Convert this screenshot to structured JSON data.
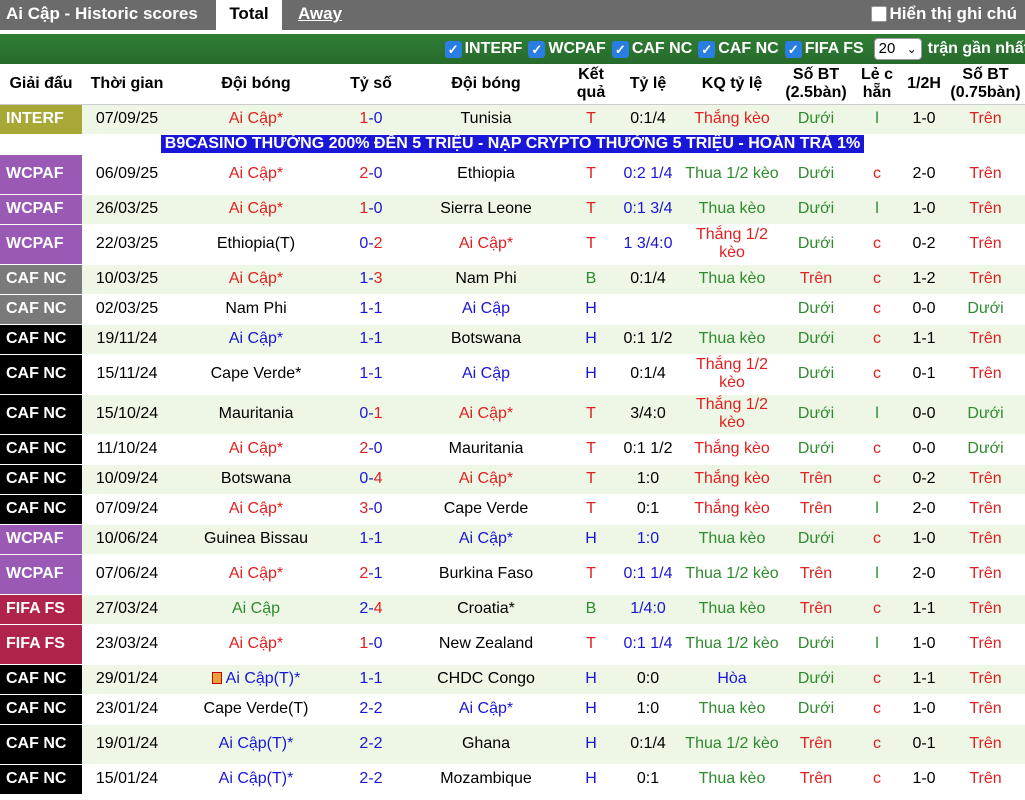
{
  "topbar": {
    "title": "Ai Cập - Historic scores",
    "tab_total": "Total",
    "tab_away": "Away",
    "show_note_label": "Hiển thị ghi chú"
  },
  "filters": {
    "items": [
      "INTERF",
      "WCPAF",
      "CAF NC",
      "CAF NC",
      "FIFA FS"
    ],
    "select_value": "20",
    "select_suffix": "trận gần nhất"
  },
  "headers": [
    "Giải đấu",
    "Thời gian",
    "Đội bóng",
    "Tỷ số",
    "Đội bóng",
    "Kết quả",
    "Tỷ lệ",
    "KQ tỷ lệ",
    "Số BT (2.5bàn)",
    "Lẻ c hẵn",
    "1/2H",
    "Số BT (0.75bàn)"
  ],
  "banner": "B9CASINO THƯỞNG 200% ĐẾN 5 TRIỆU - NẠP CRYPTO THƯỞNG 5 TRIỆU - HOÀN TRẢ 1%",
  "league_colors": {
    "INTERF": "#a8a838",
    "WCPAF": "#9b59b6",
    "CAF NC": "#000000",
    "CAF NC gray": "#7a7a7a",
    "FIFA FS": "#b0234a"
  },
  "rows": [
    {
      "league": "INTERF",
      "color": "#a8a838",
      "date": "07/09/25",
      "home": "Ai Cập*",
      "hc": "red",
      "s1": "1",
      "s2": "0",
      "away": "Tunisia",
      "ac": "dk",
      "res": "T",
      "rc": "red",
      "odds": "0:1/4",
      "oc": "dk",
      "kq": "Thắng kèo",
      "kc": "red",
      "bt": "Dưới",
      "bc": "green",
      "lc": "l",
      "lcc": "green",
      "h": "1-0",
      "bt2": "Trên",
      "b2c": "red",
      "tall": false
    },
    {
      "league": "WCPAF",
      "color": "#9b59b6",
      "date": "06/09/25",
      "home": "Ai Cập*",
      "hc": "red",
      "s1": "2",
      "s2": "0",
      "away": "Ethiopia",
      "ac": "dk",
      "res": "T",
      "rc": "red",
      "odds": "0:2 1/4",
      "oc": "blue",
      "kq": "Thua 1/2 kèo",
      "kc": "green",
      "bt": "Dưới",
      "bc": "green",
      "lc": "c",
      "lcc": "red",
      "h": "2-0",
      "bt2": "Trên",
      "b2c": "red",
      "tall": true
    },
    {
      "league": "WCPAF",
      "color": "#9b59b6",
      "date": "26/03/25",
      "home": "Ai Cập*",
      "hc": "red",
      "s1": "1",
      "s2": "0",
      "away": "Sierra Leone",
      "ac": "dk",
      "res": "T",
      "rc": "red",
      "odds": "0:1 3/4",
      "oc": "blue",
      "kq": "Thua kèo",
      "kc": "green",
      "bt": "Dưới",
      "bc": "green",
      "lc": "l",
      "lcc": "green",
      "h": "1-0",
      "bt2": "Trên",
      "b2c": "red",
      "tall": false
    },
    {
      "league": "WCPAF",
      "color": "#9b59b6",
      "date": "22/03/25",
      "home": "Ethiopia(T)",
      "hc": "dk",
      "s1": "0",
      "s2": "2",
      "away": "Ai Cập*",
      "ac": "red",
      "res": "T",
      "rc": "red",
      "odds": "1 3/4:0",
      "oc": "blue",
      "kq": "Thắng 1/2 kèo",
      "kc": "red",
      "bt": "Dưới",
      "bc": "green",
      "lc": "c",
      "lcc": "red",
      "h": "0-2",
      "bt2": "Trên",
      "b2c": "red",
      "tall": true
    },
    {
      "league": "CAF NC",
      "color": "#7a7a7a",
      "date": "10/03/25",
      "home": "Ai Cập*",
      "hc": "red",
      "s1": "1",
      "s2": "3",
      "away": "Nam Phi",
      "ac": "dk",
      "res": "B",
      "rc": "green",
      "odds": "0:1/4",
      "oc": "dk",
      "kq": "Thua kèo",
      "kc": "green",
      "bt": "Trên",
      "bc": "red",
      "lc": "c",
      "lcc": "red",
      "h": "1-2",
      "bt2": "Trên",
      "b2c": "red",
      "tall": false
    },
    {
      "league": "CAF NC",
      "color": "#7a7a7a",
      "date": "02/03/25",
      "home": "Nam Phi",
      "hc": "dk",
      "s1": "1",
      "s2": "1",
      "away": "Ai Cập",
      "ac": "blue",
      "res": "H",
      "rc": "blue",
      "odds": "",
      "oc": "dk",
      "kq": "",
      "kc": "dk",
      "bt": "Dưới",
      "bc": "green",
      "lc": "c",
      "lcc": "red",
      "h": "0-0",
      "bt2": "Dưới",
      "b2c": "green",
      "tall": false
    },
    {
      "league": "CAF NC",
      "color": "#000000",
      "date": "19/11/24",
      "home": "Ai Cập*",
      "hc": "blue",
      "s1": "1",
      "s2": "1",
      "away": "Botswana",
      "ac": "dk",
      "res": "H",
      "rc": "blue",
      "odds": "0:1 1/2",
      "oc": "dk",
      "kq": "Thua kèo",
      "kc": "green",
      "bt": "Dưới",
      "bc": "green",
      "lc": "c",
      "lcc": "red",
      "h": "1-1",
      "bt2": "Trên",
      "b2c": "red",
      "tall": false
    },
    {
      "league": "CAF NC",
      "color": "#000000",
      "date": "15/11/24",
      "home": "Cape Verde*",
      "hc": "dk",
      "s1": "1",
      "s2": "1",
      "away": "Ai Cập",
      "ac": "blue",
      "res": "H",
      "rc": "blue",
      "odds": "0:1/4",
      "oc": "dk",
      "kq": "Thắng 1/2 kèo",
      "kc": "red",
      "bt": "Dưới",
      "bc": "green",
      "lc": "c",
      "lcc": "red",
      "h": "0-1",
      "bt2": "Trên",
      "b2c": "red",
      "tall": true
    },
    {
      "league": "CAF NC",
      "color": "#000000",
      "date": "15/10/24",
      "home": "Mauritania",
      "hc": "dk",
      "s1": "0",
      "s2": "1",
      "away": "Ai Cập*",
      "ac": "red",
      "res": "T",
      "rc": "red",
      "odds": "3/4:0",
      "oc": "dk",
      "kq": "Thắng 1/2 kèo",
      "kc": "red",
      "bt": "Dưới",
      "bc": "green",
      "lc": "l",
      "lcc": "green",
      "h": "0-0",
      "bt2": "Dưới",
      "b2c": "green",
      "tall": true
    },
    {
      "league": "CAF NC",
      "color": "#000000",
      "date": "11/10/24",
      "home": "Ai Cập*",
      "hc": "red",
      "s1": "2",
      "s2": "0",
      "away": "Mauritania",
      "ac": "dk",
      "res": "T",
      "rc": "red",
      "odds": "0:1 1/2",
      "oc": "dk",
      "kq": "Thắng kèo",
      "kc": "red",
      "bt": "Dưới",
      "bc": "green",
      "lc": "c",
      "lcc": "red",
      "h": "0-0",
      "bt2": "Dưới",
      "b2c": "green",
      "tall": false
    },
    {
      "league": "CAF NC",
      "color": "#000000",
      "date": "10/09/24",
      "home": "Botswana",
      "hc": "dk",
      "s1": "0",
      "s2": "4",
      "away": "Ai Cập*",
      "ac": "red",
      "res": "T",
      "rc": "red",
      "odds": "1:0",
      "oc": "dk",
      "kq": "Thắng kèo",
      "kc": "red",
      "bt": "Trên",
      "bc": "red",
      "lc": "c",
      "lcc": "red",
      "h": "0-2",
      "bt2": "Trên",
      "b2c": "red",
      "tall": false
    },
    {
      "league": "CAF NC",
      "color": "#000000",
      "date": "07/09/24",
      "home": "Ai Cập*",
      "hc": "red",
      "s1": "3",
      "s2": "0",
      "away": "Cape Verde",
      "ac": "dk",
      "res": "T",
      "rc": "red",
      "odds": "0:1",
      "oc": "dk",
      "kq": "Thắng kèo",
      "kc": "red",
      "bt": "Trên",
      "bc": "red",
      "lc": "l",
      "lcc": "green",
      "h": "2-0",
      "bt2": "Trên",
      "b2c": "red",
      "tall": false
    },
    {
      "league": "WCPAF",
      "color": "#9b59b6",
      "date": "10/06/24",
      "home": "Guinea Bissau",
      "hc": "dk",
      "s1": "1",
      "s2": "1",
      "away": "Ai Cập*",
      "ac": "blue",
      "res": "H",
      "rc": "blue",
      "odds": "1:0",
      "oc": "blue",
      "kq": "Thua kèo",
      "kc": "green",
      "bt": "Dưới",
      "bc": "green",
      "lc": "c",
      "lcc": "red",
      "h": "1-0",
      "bt2": "Trên",
      "b2c": "red",
      "tall": false
    },
    {
      "league": "WCPAF",
      "color": "#9b59b6",
      "date": "07/06/24",
      "home": "Ai Cập*",
      "hc": "red",
      "s1": "2",
      "s2": "1",
      "away": "Burkina Faso",
      "ac": "dk",
      "res": "T",
      "rc": "red",
      "odds": "0:1 1/4",
      "oc": "blue",
      "kq": "Thua 1/2 kèo",
      "kc": "green",
      "bt": "Trên",
      "bc": "red",
      "lc": "l",
      "lcc": "green",
      "h": "2-0",
      "bt2": "Trên",
      "b2c": "red",
      "tall": true
    },
    {
      "league": "FIFA FS",
      "color": "#b0234a",
      "date": "27/03/24",
      "home": "Ai Cập",
      "hc": "green",
      "s1": "2",
      "s2": "4",
      "away": "Croatia*",
      "ac": "dk",
      "res": "B",
      "rc": "green",
      "odds": "1/4:0",
      "oc": "blue",
      "kq": "Thua kèo",
      "kc": "green",
      "bt": "Trên",
      "bc": "red",
      "lc": "c",
      "lcc": "red",
      "h": "1-1",
      "bt2": "Trên",
      "b2c": "red",
      "tall": false
    },
    {
      "league": "FIFA FS",
      "color": "#b0234a",
      "date": "23/03/24",
      "home": "Ai Cập*",
      "hc": "red",
      "s1": "1",
      "s2": "0",
      "away": "New Zealand",
      "ac": "dk",
      "res": "T",
      "rc": "red",
      "odds": "0:1 1/4",
      "oc": "blue",
      "kq": "Thua 1/2 kèo",
      "kc": "green",
      "bt": "Dưới",
      "bc": "green",
      "lc": "l",
      "lcc": "green",
      "h": "1-0",
      "bt2": "Trên",
      "b2c": "red",
      "tall": true
    },
    {
      "league": "CAF NC",
      "color": "#000000",
      "date": "29/01/24",
      "home": "Ai Cập(T)*",
      "hc": "blue",
      "flag": true,
      "s1": "1",
      "s2": "1",
      "away": "CHDC Congo",
      "ac": "dk",
      "res": "H",
      "rc": "blue",
      "odds": "0:0",
      "oc": "dk",
      "kq": "Hòa",
      "kc": "blue",
      "bt": "Dưới",
      "bc": "green",
      "lc": "c",
      "lcc": "red",
      "h": "1-1",
      "bt2": "Trên",
      "b2c": "red",
      "tall": false
    },
    {
      "league": "CAF NC",
      "color": "#000000",
      "date": "23/01/24",
      "home": "Cape Verde(T)",
      "hc": "dk",
      "s1": "2",
      "s2": "2",
      "away": "Ai Cập*",
      "ac": "blue",
      "res": "H",
      "rc": "blue",
      "odds": "1:0",
      "oc": "dk",
      "kq": "Thua kèo",
      "kc": "green",
      "bt": "Dưới",
      "bc": "green",
      "lc": "c",
      "lcc": "red",
      "h": "1-0",
      "bt2": "Trên",
      "b2c": "red",
      "tall": false
    },
    {
      "league": "CAF NC",
      "color": "#000000",
      "date": "19/01/24",
      "home": "Ai Cập(T)*",
      "hc": "blue",
      "s1": "2",
      "s2": "2",
      "away": "Ghana",
      "ac": "dk",
      "res": "H",
      "rc": "blue",
      "odds": "0:1/4",
      "oc": "dk",
      "kq": "Thua 1/2 kèo",
      "kc": "green",
      "bt": "Trên",
      "bc": "red",
      "lc": "c",
      "lcc": "red",
      "h": "0-1",
      "bt2": "Trên",
      "b2c": "red",
      "tall": true
    },
    {
      "league": "CAF NC",
      "color": "#000000",
      "date": "15/01/24",
      "home": "Ai Cập(T)*",
      "hc": "blue",
      "s1": "2",
      "s2": "2",
      "away": "Mozambique",
      "ac": "dk",
      "res": "H",
      "rc": "blue",
      "odds": "0:1",
      "oc": "dk",
      "kq": "Thua kèo",
      "kc": "green",
      "bt": "Trên",
      "bc": "red",
      "lc": "c",
      "lcc": "red",
      "h": "1-0",
      "bt2": "Trên",
      "b2c": "red",
      "tall": false
    }
  ]
}
